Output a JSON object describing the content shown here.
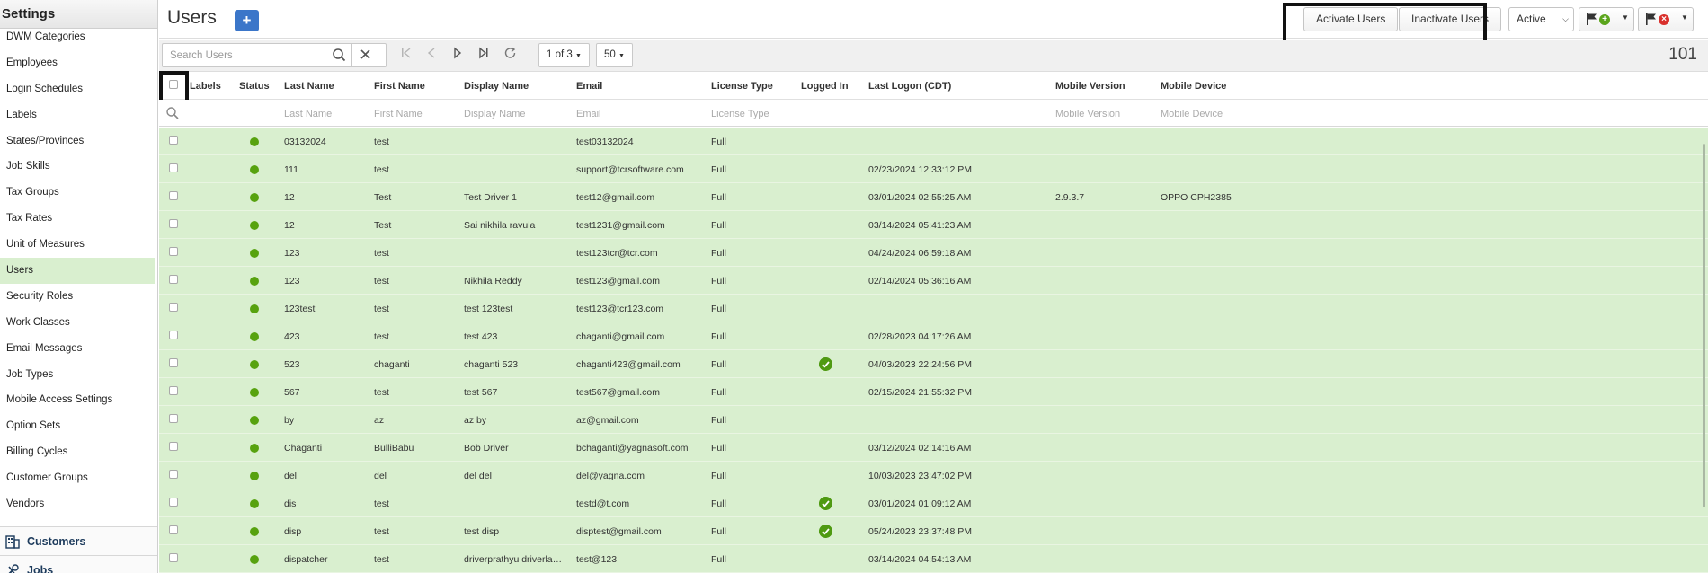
{
  "sidebar": {
    "title": "Settings",
    "items": [
      {
        "label": "DWM Categories",
        "active": false
      },
      {
        "label": "Employees",
        "active": false
      },
      {
        "label": "Login Schedules",
        "active": false
      },
      {
        "label": "Labels",
        "active": false
      },
      {
        "label": "States/Provinces",
        "active": false
      },
      {
        "label": "Job Skills",
        "active": false
      },
      {
        "label": "Tax Groups",
        "active": false
      },
      {
        "label": "Tax Rates",
        "active": false
      },
      {
        "label": "Unit of Measures",
        "active": false
      },
      {
        "label": "Users",
        "active": true
      },
      {
        "label": "Security Roles",
        "active": false
      },
      {
        "label": "Work Classes",
        "active": false
      },
      {
        "label": "Email Messages",
        "active": false
      },
      {
        "label": "Job Types",
        "active": false
      },
      {
        "label": "Mobile Access Settings",
        "active": false
      },
      {
        "label": "Option Sets",
        "active": false
      },
      {
        "label": "Billing Cycles",
        "active": false
      },
      {
        "label": "Customer Groups",
        "active": false
      },
      {
        "label": "Vendors",
        "active": false
      }
    ],
    "sections": [
      {
        "label": "Customers",
        "icon": "building-icon"
      },
      {
        "label": "Jobs",
        "icon": "tools-icon"
      }
    ]
  },
  "header": {
    "title": "Users",
    "add_label": "+",
    "activate_label": "Activate Users",
    "inactivate_label": "Inactivate Users",
    "status_value": "Active",
    "flag_add_icon": "flag-add-icon",
    "flag_remove_icon": "flag-remove-icon"
  },
  "toolbar": {
    "search_placeholder": "Search Users",
    "page_label": "1 of 3",
    "page_size": "50",
    "total": "101"
  },
  "columns": [
    "Labels",
    "Status",
    "Last Name",
    "First Name",
    "Display Name",
    "Email",
    "License Type",
    "Logged In",
    "Last Logon (CDT)",
    "Mobile Version",
    "Mobile Device"
  ],
  "filters": [
    "Last Name",
    "First Name",
    "Display Name",
    "Email",
    "License Type",
    "Mobile Version",
    "Mobile Device"
  ],
  "rows": [
    {
      "last": "03132024",
      "first": "test",
      "display": "",
      "email": "test03132024",
      "license": "Full",
      "logged": false,
      "logon": "",
      "mver": "",
      "mdev": ""
    },
    {
      "last": "111",
      "first": "test",
      "display": "",
      "email": "support@tcrsoftware.com",
      "license": "Full",
      "logged": false,
      "logon": "02/23/2024 12:33:12 PM",
      "mver": "",
      "mdev": ""
    },
    {
      "last": "12",
      "first": "Test",
      "display": "Test Driver 1",
      "email": "test12@gmail.com",
      "license": "Full",
      "logged": false,
      "logon": "03/01/2024 02:55:25 AM",
      "mver": "2.9.3.7",
      "mdev": "OPPO CPH2385"
    },
    {
      "last": "12",
      "first": "Test",
      "display": "Sai nikhila ravula",
      "email": "test1231@gmail.com",
      "license": "Full",
      "logged": false,
      "logon": "03/14/2024 05:41:23 AM",
      "mver": "",
      "mdev": ""
    },
    {
      "last": "123",
      "first": "test",
      "display": "",
      "email": "test123tcr@tcr.com",
      "license": "Full",
      "logged": false,
      "logon": "04/24/2024 06:59:18 AM",
      "mver": "",
      "mdev": ""
    },
    {
      "last": "123",
      "first": "test",
      "display": "Nikhila Reddy",
      "email": "test123@gmail.com",
      "license": "Full",
      "logged": false,
      "logon": "02/14/2024 05:36:16 AM",
      "mver": "",
      "mdev": ""
    },
    {
      "last": "123test",
      "first": "test",
      "display": "test 123test",
      "email": "test123@tcr123.com",
      "license": "Full",
      "logged": false,
      "logon": "",
      "mver": "",
      "mdev": ""
    },
    {
      "last": "423",
      "first": "test",
      "display": "test 423",
      "email": "chaganti@gmail.com",
      "license": "Full",
      "logged": false,
      "logon": "02/28/2023 04:17:26 AM",
      "mver": "",
      "mdev": ""
    },
    {
      "last": "523",
      "first": "chaganti",
      "display": "chaganti 523",
      "email": "chaganti423@gmail.com",
      "license": "Full",
      "logged": true,
      "logon": "04/03/2023 22:24:56 PM",
      "mver": "",
      "mdev": ""
    },
    {
      "last": "567",
      "first": "test",
      "display": "test 567",
      "email": "test567@gmail.com",
      "license": "Full",
      "logged": false,
      "logon": "02/15/2024 21:55:32 PM",
      "mver": "",
      "mdev": ""
    },
    {
      "last": "by",
      "first": "az",
      "display": "az by",
      "email": "az@gmail.com",
      "license": "Full",
      "logged": false,
      "logon": "",
      "mver": "",
      "mdev": ""
    },
    {
      "last": "Chaganti",
      "first": "BulliBabu",
      "display": "Bob Driver",
      "email": "bchaganti@yagnasoft.com",
      "license": "Full",
      "logged": false,
      "logon": "03/12/2024 02:14:16 AM",
      "mver": "",
      "mdev": ""
    },
    {
      "last": "del",
      "first": "del",
      "display": "del del",
      "email": "del@yagna.com",
      "license": "Full",
      "logged": false,
      "logon": "10/03/2023 23:47:02 PM",
      "mver": "",
      "mdev": ""
    },
    {
      "last": "dis",
      "first": "test",
      "display": "",
      "email": "testd@t.com",
      "license": "Full",
      "logged": true,
      "logon": "03/01/2024 01:09:12 AM",
      "mver": "",
      "mdev": ""
    },
    {
      "last": "disp",
      "first": "test",
      "display": "test disp",
      "email": "disptest@gmail.com",
      "license": "Full",
      "logged": true,
      "logon": "05/24/2023 23:37:48 PM",
      "mver": "",
      "mdev": ""
    },
    {
      "last": "dispatcher",
      "first": "test",
      "display": "driverprathyu driverla…",
      "email": "test@123",
      "license": "Full",
      "logged": false,
      "logon": "03/14/2024 04:54:13 AM",
      "mver": "",
      "mdev": ""
    }
  ],
  "colors": {
    "accent": "#3b76c9",
    "row_bg": "#d9efcf",
    "status_active": "#57a20f"
  }
}
